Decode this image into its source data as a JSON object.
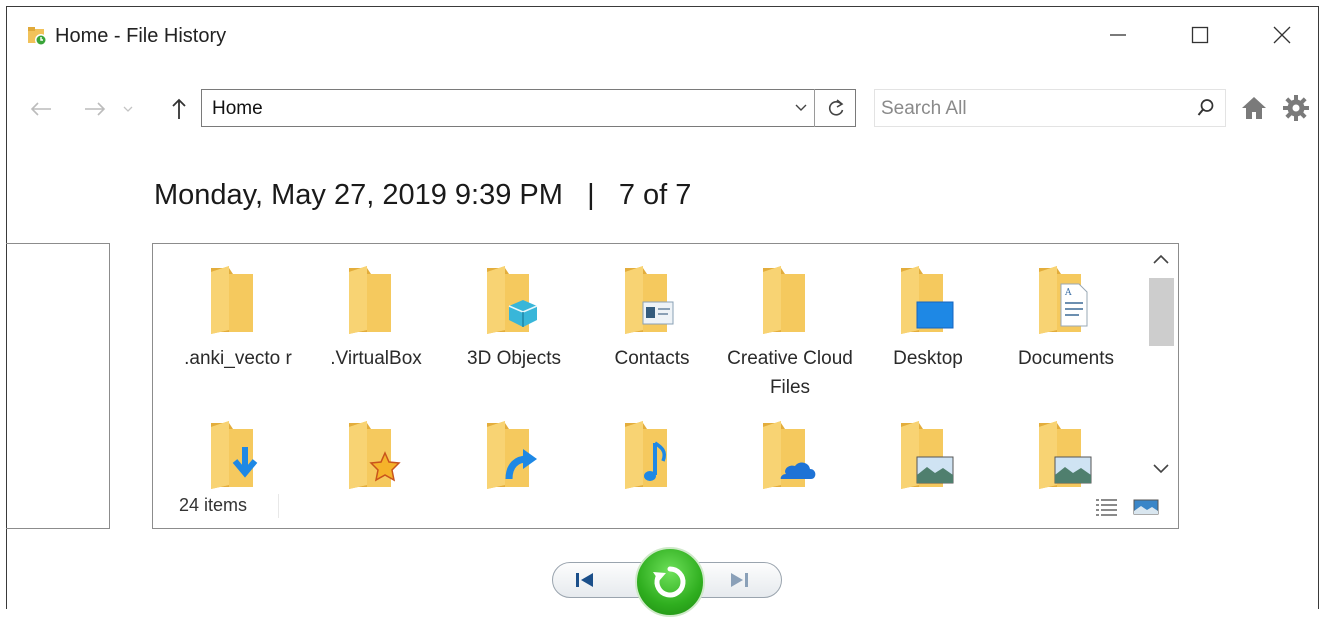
{
  "window": {
    "title": "Home - File History"
  },
  "nav": {
    "address": "Home",
    "search_placeholder": "Search All"
  },
  "heading": {
    "date": "Monday, May 27, 2019 9:39 PM",
    "separator": "|",
    "position": "7 of 7"
  },
  "items": [
    {
      "label": ".anki_vecto r",
      "icon": "folder"
    },
    {
      "label": ".VirtualBox",
      "icon": "folder"
    },
    {
      "label": "3D Objects",
      "icon": "folder-3d-objects"
    },
    {
      "label": "Contacts",
      "icon": "folder-contacts"
    },
    {
      "label": "Creative Cloud Files",
      "icon": "folder"
    },
    {
      "label": "Desktop",
      "icon": "folder-desktop"
    },
    {
      "label": "Documents",
      "icon": "folder-documents"
    },
    {
      "label": "",
      "icon": "folder-downloads"
    },
    {
      "label": "",
      "icon": "folder-favorites"
    },
    {
      "label": "",
      "icon": "folder-links"
    },
    {
      "label": "",
      "icon": "folder-music"
    },
    {
      "label": "",
      "icon": "folder-onedrive"
    },
    {
      "label": "",
      "icon": "folder-pictures"
    },
    {
      "label": "",
      "icon": "folder-pictures"
    }
  ],
  "status": {
    "count": "24 items"
  },
  "colors": {
    "folder": "#f5c95e",
    "folder_dark": "#e3ad3c",
    "accent_blue": "#1e88e5",
    "restore_green": "#2fae1f"
  }
}
